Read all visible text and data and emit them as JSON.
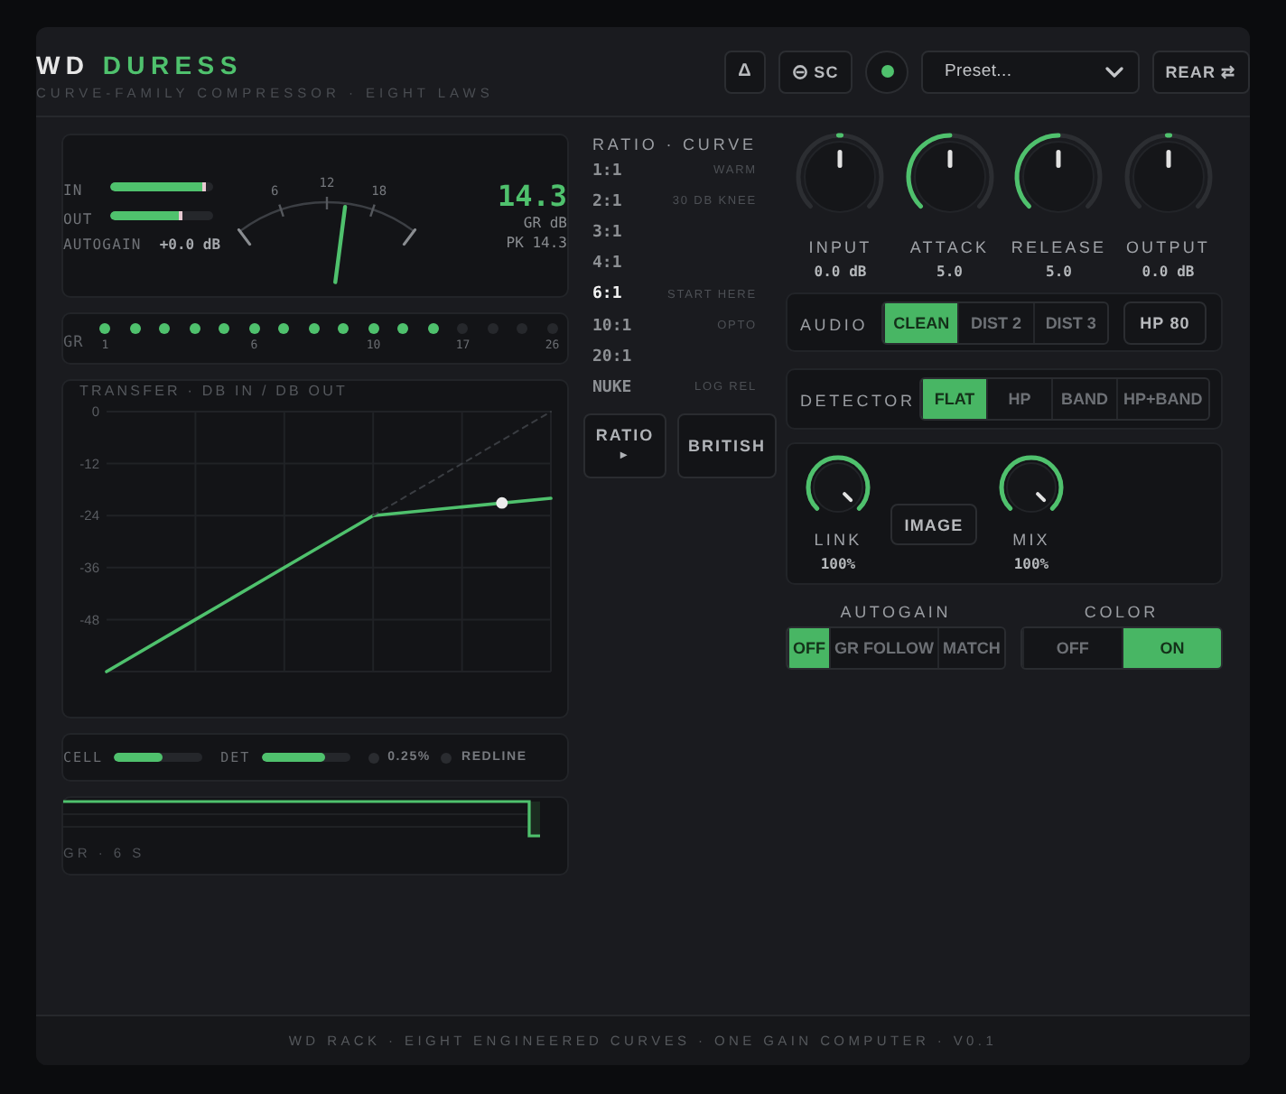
{
  "header": {
    "brand": {
      "prefix": "WD",
      "name": "DURESS"
    },
    "subtitle": "CURVE-FAMILY COMPRESSOR · EIGHT LAWS",
    "delta_button": "Δ",
    "sidechain_button": "SC",
    "active_toggle": {
      "on": true
    },
    "preset": {
      "value": "Preset..."
    },
    "rear_button": "REAR ⇄"
  },
  "meter": {
    "bars": [
      {
        "label": "IN",
        "level": 0.93
      },
      {
        "label": "OUT",
        "level": 0.7
      }
    ],
    "autogain": {
      "label": "AUTOGAIN",
      "value": "+0.0 dB"
    },
    "vu": {
      "ticks": [
        "6",
        "12",
        "18"
      ],
      "level": 0.6
    },
    "readout": {
      "value": "14.3",
      "unit": "GR dB",
      "peak": "PK 14.3"
    }
  },
  "gr_leds": {
    "label": "GR",
    "leds": [
      {
        "on": true,
        "label": "1"
      },
      {
        "on": true
      },
      {
        "on": true
      },
      {
        "on": true
      },
      {
        "on": true
      },
      {
        "on": true,
        "label": "6"
      },
      {
        "on": true
      },
      {
        "on": true
      },
      {
        "on": true
      },
      {
        "on": true,
        "label": "10"
      },
      {
        "on": true
      },
      {
        "on": true
      },
      {
        "on": false,
        "label": "17"
      },
      {
        "on": false
      },
      {
        "on": false
      },
      {
        "on": false,
        "label": "26"
      }
    ]
  },
  "transfer": {
    "chart_data": {
      "type": "line",
      "title": "TRANSFER · DB IN / DB OUT",
      "categories": [
        null,
        null,
        null,
        null,
        null,
        null
      ],
      "series": [
        {
          "color": "#4fc16d",
          "line_style": "solid",
          "values": [
            -60,
            -48,
            -36,
            -24,
            -22,
            -20
          ]
        },
        {
          "color": "#3a3d42",
          "line_style": "dashed",
          "values": [
            null,
            null,
            null,
            -24,
            -12,
            0
          ]
        }
      ],
      "ylim": [
        -60,
        0
      ],
      "yticks": [
        0,
        -12,
        -24,
        -36,
        -48
      ],
      "grid": true
    },
    "marker": {
      "level": 0.89
    }
  },
  "cells": {
    "meters": [
      {
        "label": "CELL",
        "level": 0.55
      },
      {
        "label": "DET",
        "level": 0.73
      }
    ],
    "indicators": [
      {
        "label": "0.25%",
        "on": false
      },
      {
        "label": "REDLINE",
        "on": false
      }
    ]
  },
  "gr_history": {
    "label": "GR · 6 S"
  },
  "ratio_curve": {
    "title": "RATIO · CURVE",
    "options": [
      {
        "ratio": "1:1",
        "curve": "WARM",
        "selected": false
      },
      {
        "ratio": "2:1",
        "curve": "30 DB KNEE",
        "selected": false
      },
      {
        "ratio": "3:1",
        "selected": false
      },
      {
        "ratio": "4:1",
        "selected": false
      },
      {
        "ratio": "6:1",
        "curve": "START HERE",
        "selected": true
      },
      {
        "ratio": "10:1",
        "curve": "OPTO",
        "selected": false
      },
      {
        "ratio": "20:1",
        "selected": false
      },
      {
        "ratio": "NUKE",
        "curve": "LOG REL",
        "selected": false
      }
    ],
    "buttons": [
      {
        "kind": "menu",
        "label": "RATIO",
        "glyph": "▸"
      },
      {
        "kind": "plain",
        "label": "BRITISH"
      }
    ]
  },
  "knobs": [
    {
      "label": "INPUT",
      "value": "0.0 dB",
      "level": 0.5,
      "kind": "bipolar"
    },
    {
      "label": "ATTACK",
      "value": "5.0",
      "level": 0.5,
      "kind": "unipolar"
    },
    {
      "label": "RELEASE",
      "value": "5.0",
      "level": 0.5,
      "kind": "unipolar"
    },
    {
      "label": "OUTPUT",
      "value": "0.0 dB",
      "level": 0.5,
      "kind": "bipolar"
    }
  ],
  "audio": {
    "label": "AUDIO",
    "options": [
      {
        "label": "CLEAN",
        "selected": true
      },
      {
        "label": "DIST 2",
        "selected": false
      },
      {
        "label": "DIST 3",
        "selected": false
      }
    ],
    "filter_button": "HP 80"
  },
  "detector": {
    "label": "DETECTOR",
    "options": [
      {
        "label": "FLAT",
        "selected": true
      },
      {
        "label": "HP",
        "selected": false
      },
      {
        "label": "BAND",
        "selected": false
      },
      {
        "label": "HP+BAND",
        "selected": false
      }
    ]
  },
  "stereo": {
    "knobs": [
      {
        "label": "LINK",
        "value": "100%",
        "level": 1,
        "kind": "unipolar"
      },
      {
        "label": "MIX",
        "value": "100%",
        "level": 1,
        "kind": "unipolar"
      }
    ],
    "image_button": "IMAGE"
  },
  "autogain": {
    "label": "AUTOGAIN",
    "options": [
      {
        "label": "OFF",
        "selected": true
      },
      {
        "label": "GR FOLLOW",
        "selected": false
      },
      {
        "label": "MATCH",
        "selected": false
      }
    ]
  },
  "color": {
    "label": "COLOR",
    "options": [
      {
        "label": "OFF",
        "selected": false
      },
      {
        "label": "ON",
        "selected": true
      }
    ]
  },
  "footer": "WD RACK · EIGHT ENGINEERED CURVES · ONE GAIN COMPUTER · V0.1"
}
